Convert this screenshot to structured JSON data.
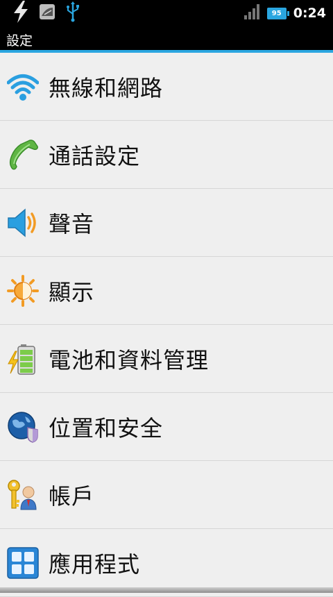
{
  "status_bar": {
    "time": "0:24",
    "battery_level": "95",
    "notification_icons": [
      "flash-icon",
      "notification-image-icon",
      "usb-icon"
    ],
    "signal_icon": "signal-strength-icon"
  },
  "title_bar": {
    "title": "設定"
  },
  "accent_color": "#2aa6e0",
  "settings_items": [
    {
      "label": "無線和網路",
      "icon": "wifi-icon"
    },
    {
      "label": "通話設定",
      "icon": "phone-handset-icon"
    },
    {
      "label": "聲音",
      "icon": "speaker-icon"
    },
    {
      "label": "顯示",
      "icon": "brightness-sun-icon"
    },
    {
      "label": "電池和資料管理",
      "icon": "battery-charging-icon"
    },
    {
      "label": "位置和安全",
      "icon": "globe-shield-icon"
    },
    {
      "label": "帳戶",
      "icon": "account-key-icon"
    },
    {
      "label": "應用程式",
      "icon": "applications-grid-icon"
    }
  ]
}
